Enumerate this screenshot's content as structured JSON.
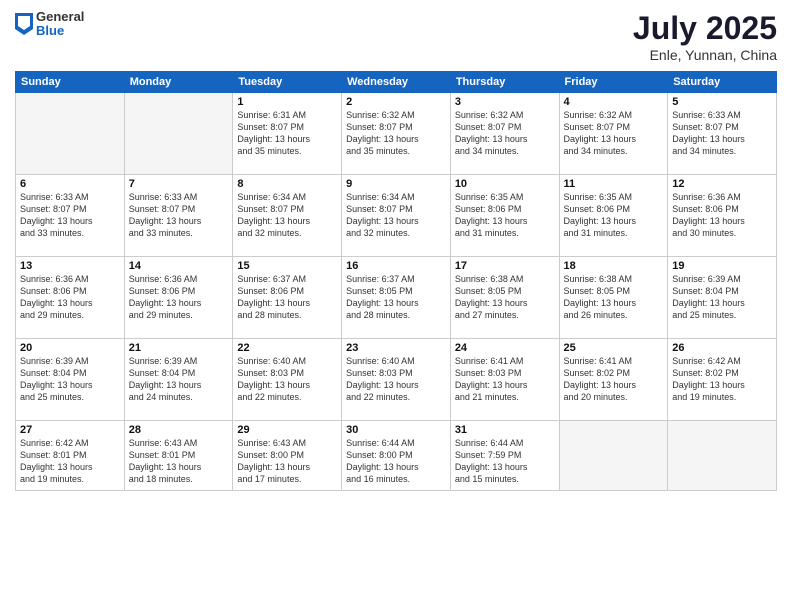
{
  "logo": {
    "general": "General",
    "blue": "Blue"
  },
  "header": {
    "month": "July 2025",
    "location": "Enle, Yunnan, China"
  },
  "weekdays": [
    "Sunday",
    "Monday",
    "Tuesday",
    "Wednesday",
    "Thursday",
    "Friday",
    "Saturday"
  ],
  "weeks": [
    [
      {
        "day": "",
        "info": ""
      },
      {
        "day": "",
        "info": ""
      },
      {
        "day": "1",
        "info": "Sunrise: 6:31 AM\nSunset: 8:07 PM\nDaylight: 13 hours\nand 35 minutes."
      },
      {
        "day": "2",
        "info": "Sunrise: 6:32 AM\nSunset: 8:07 PM\nDaylight: 13 hours\nand 35 minutes."
      },
      {
        "day": "3",
        "info": "Sunrise: 6:32 AM\nSunset: 8:07 PM\nDaylight: 13 hours\nand 34 minutes."
      },
      {
        "day": "4",
        "info": "Sunrise: 6:32 AM\nSunset: 8:07 PM\nDaylight: 13 hours\nand 34 minutes."
      },
      {
        "day": "5",
        "info": "Sunrise: 6:33 AM\nSunset: 8:07 PM\nDaylight: 13 hours\nand 34 minutes."
      }
    ],
    [
      {
        "day": "6",
        "info": "Sunrise: 6:33 AM\nSunset: 8:07 PM\nDaylight: 13 hours\nand 33 minutes."
      },
      {
        "day": "7",
        "info": "Sunrise: 6:33 AM\nSunset: 8:07 PM\nDaylight: 13 hours\nand 33 minutes."
      },
      {
        "day": "8",
        "info": "Sunrise: 6:34 AM\nSunset: 8:07 PM\nDaylight: 13 hours\nand 32 minutes."
      },
      {
        "day": "9",
        "info": "Sunrise: 6:34 AM\nSunset: 8:07 PM\nDaylight: 13 hours\nand 32 minutes."
      },
      {
        "day": "10",
        "info": "Sunrise: 6:35 AM\nSunset: 8:06 PM\nDaylight: 13 hours\nand 31 minutes."
      },
      {
        "day": "11",
        "info": "Sunrise: 6:35 AM\nSunset: 8:06 PM\nDaylight: 13 hours\nand 31 minutes."
      },
      {
        "day": "12",
        "info": "Sunrise: 6:36 AM\nSunset: 8:06 PM\nDaylight: 13 hours\nand 30 minutes."
      }
    ],
    [
      {
        "day": "13",
        "info": "Sunrise: 6:36 AM\nSunset: 8:06 PM\nDaylight: 13 hours\nand 29 minutes."
      },
      {
        "day": "14",
        "info": "Sunrise: 6:36 AM\nSunset: 8:06 PM\nDaylight: 13 hours\nand 29 minutes."
      },
      {
        "day": "15",
        "info": "Sunrise: 6:37 AM\nSunset: 8:06 PM\nDaylight: 13 hours\nand 28 minutes."
      },
      {
        "day": "16",
        "info": "Sunrise: 6:37 AM\nSunset: 8:05 PM\nDaylight: 13 hours\nand 28 minutes."
      },
      {
        "day": "17",
        "info": "Sunrise: 6:38 AM\nSunset: 8:05 PM\nDaylight: 13 hours\nand 27 minutes."
      },
      {
        "day": "18",
        "info": "Sunrise: 6:38 AM\nSunset: 8:05 PM\nDaylight: 13 hours\nand 26 minutes."
      },
      {
        "day": "19",
        "info": "Sunrise: 6:39 AM\nSunset: 8:04 PM\nDaylight: 13 hours\nand 25 minutes."
      }
    ],
    [
      {
        "day": "20",
        "info": "Sunrise: 6:39 AM\nSunset: 8:04 PM\nDaylight: 13 hours\nand 25 minutes."
      },
      {
        "day": "21",
        "info": "Sunrise: 6:39 AM\nSunset: 8:04 PM\nDaylight: 13 hours\nand 24 minutes."
      },
      {
        "day": "22",
        "info": "Sunrise: 6:40 AM\nSunset: 8:03 PM\nDaylight: 13 hours\nand 22 minutes."
      },
      {
        "day": "23",
        "info": "Sunrise: 6:40 AM\nSunset: 8:03 PM\nDaylight: 13 hours\nand 22 minutes."
      },
      {
        "day": "24",
        "info": "Sunrise: 6:41 AM\nSunset: 8:03 PM\nDaylight: 13 hours\nand 21 minutes."
      },
      {
        "day": "25",
        "info": "Sunrise: 6:41 AM\nSunset: 8:02 PM\nDaylight: 13 hours\nand 20 minutes."
      },
      {
        "day": "26",
        "info": "Sunrise: 6:42 AM\nSunset: 8:02 PM\nDaylight: 13 hours\nand 19 minutes."
      }
    ],
    [
      {
        "day": "27",
        "info": "Sunrise: 6:42 AM\nSunset: 8:01 PM\nDaylight: 13 hours\nand 19 minutes."
      },
      {
        "day": "28",
        "info": "Sunrise: 6:43 AM\nSunset: 8:01 PM\nDaylight: 13 hours\nand 18 minutes."
      },
      {
        "day": "29",
        "info": "Sunrise: 6:43 AM\nSunset: 8:00 PM\nDaylight: 13 hours\nand 17 minutes."
      },
      {
        "day": "30",
        "info": "Sunrise: 6:44 AM\nSunset: 8:00 PM\nDaylight: 13 hours\nand 16 minutes."
      },
      {
        "day": "31",
        "info": "Sunrise: 6:44 AM\nSunset: 7:59 PM\nDaylight: 13 hours\nand 15 minutes."
      },
      {
        "day": "",
        "info": ""
      },
      {
        "day": "",
        "info": ""
      }
    ]
  ]
}
